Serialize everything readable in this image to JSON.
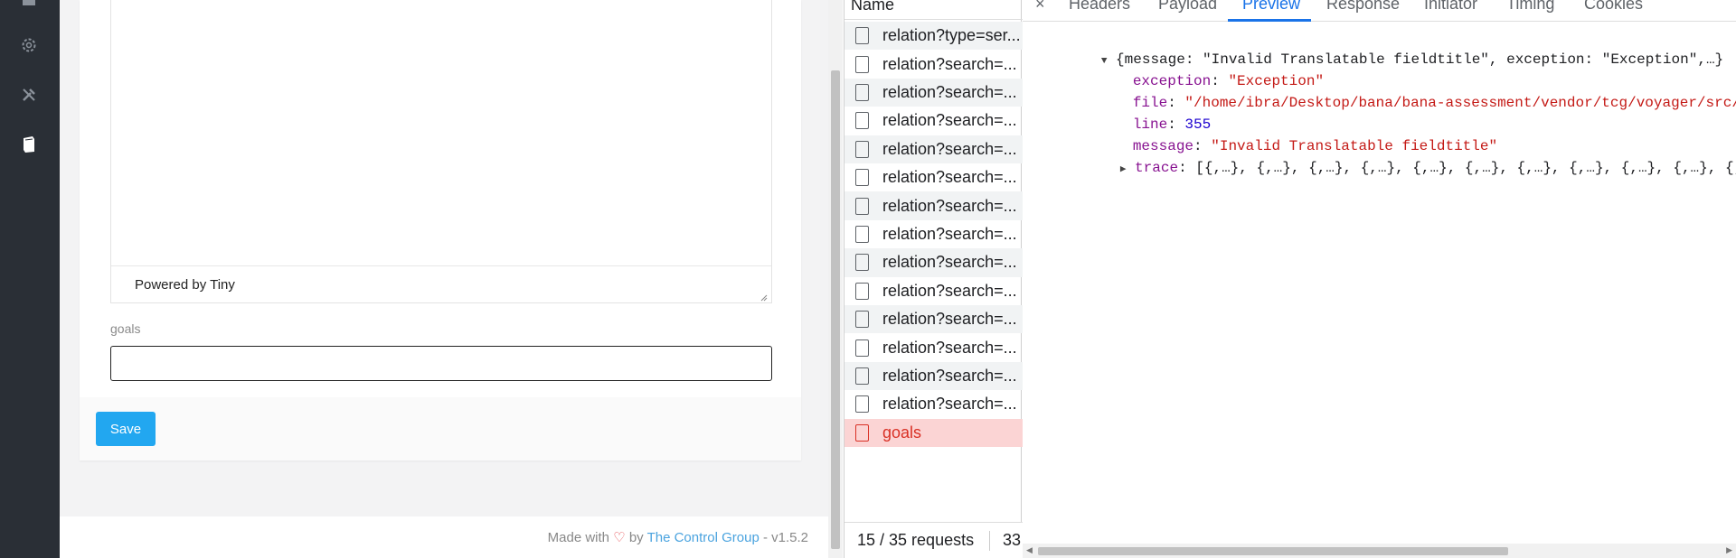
{
  "sidebar": {
    "icons": [
      "dashboard-icon",
      "gear-icon",
      "tools-icon",
      "book-icon"
    ]
  },
  "editor": {
    "powered_by": "Powered by Tiny"
  },
  "form": {
    "goals_label": "goals",
    "goals_value": "",
    "save_label": "Save"
  },
  "app_footer": {
    "made_with": "Made with",
    "by": "by",
    "link": "The Control Group",
    "version": "- v1.5.2"
  },
  "network": {
    "name_header": "Name",
    "requests": [
      {
        "name": "relation?type=ser...",
        "error": false
      },
      {
        "name": "relation?search=...",
        "error": false
      },
      {
        "name": "relation?search=...",
        "error": false
      },
      {
        "name": "relation?search=...",
        "error": false
      },
      {
        "name": "relation?search=...",
        "error": false
      },
      {
        "name": "relation?search=...",
        "error": false
      },
      {
        "name": "relation?search=...",
        "error": false
      },
      {
        "name": "relation?search=...",
        "error": false
      },
      {
        "name": "relation?search=...",
        "error": false
      },
      {
        "name": "relation?search=...",
        "error": false
      },
      {
        "name": "relation?search=...",
        "error": false
      },
      {
        "name": "relation?search=...",
        "error": false
      },
      {
        "name": "relation?search=...",
        "error": false
      },
      {
        "name": "relation?search=...",
        "error": false
      },
      {
        "name": "goals",
        "error": true
      }
    ],
    "status_requests": "15 / 35 requests",
    "status_more": "33"
  },
  "preview": {
    "close": "×",
    "tabs": [
      "Headers",
      "Payload",
      "Preview",
      "Response",
      "Initiator",
      "Timing",
      "Cookies"
    ],
    "active_tab": "Preview",
    "summary": "{message: \"Invalid Translatable fieldtitle\", exception: \"Exception\",…}",
    "fields": [
      {
        "key": "exception",
        "value": "\"Exception\"",
        "type": "string"
      },
      {
        "key": "file",
        "value": "\"/home/ibra/Desktop/bana/bana-assessment/vendor/tcg/voyager/src/Traits/Translatable.php\"",
        "type": "string"
      },
      {
        "key": "line",
        "value": "355",
        "type": "number"
      },
      {
        "key": "message",
        "value": "\"Invalid Translatable fieldtitle\"",
        "type": "string"
      }
    ],
    "trace_key": "trace",
    "trace_value": "[{,…}, {,…}, {,…}, {,…}, {,…}, {,…}, {,…}, {,…}, {,…}, {,…}, {,…}, {,…}"
  },
  "colors": {
    "sidebar_bg": "#2a2f36",
    "save_bg": "#22a7f0",
    "active_tab": "#1a73e8",
    "error_row_bg": "#fbd4d4",
    "error_text": "#d93025",
    "json_key": "#881391",
    "json_string": "#c41a16",
    "json_number": "#1c00cf"
  }
}
